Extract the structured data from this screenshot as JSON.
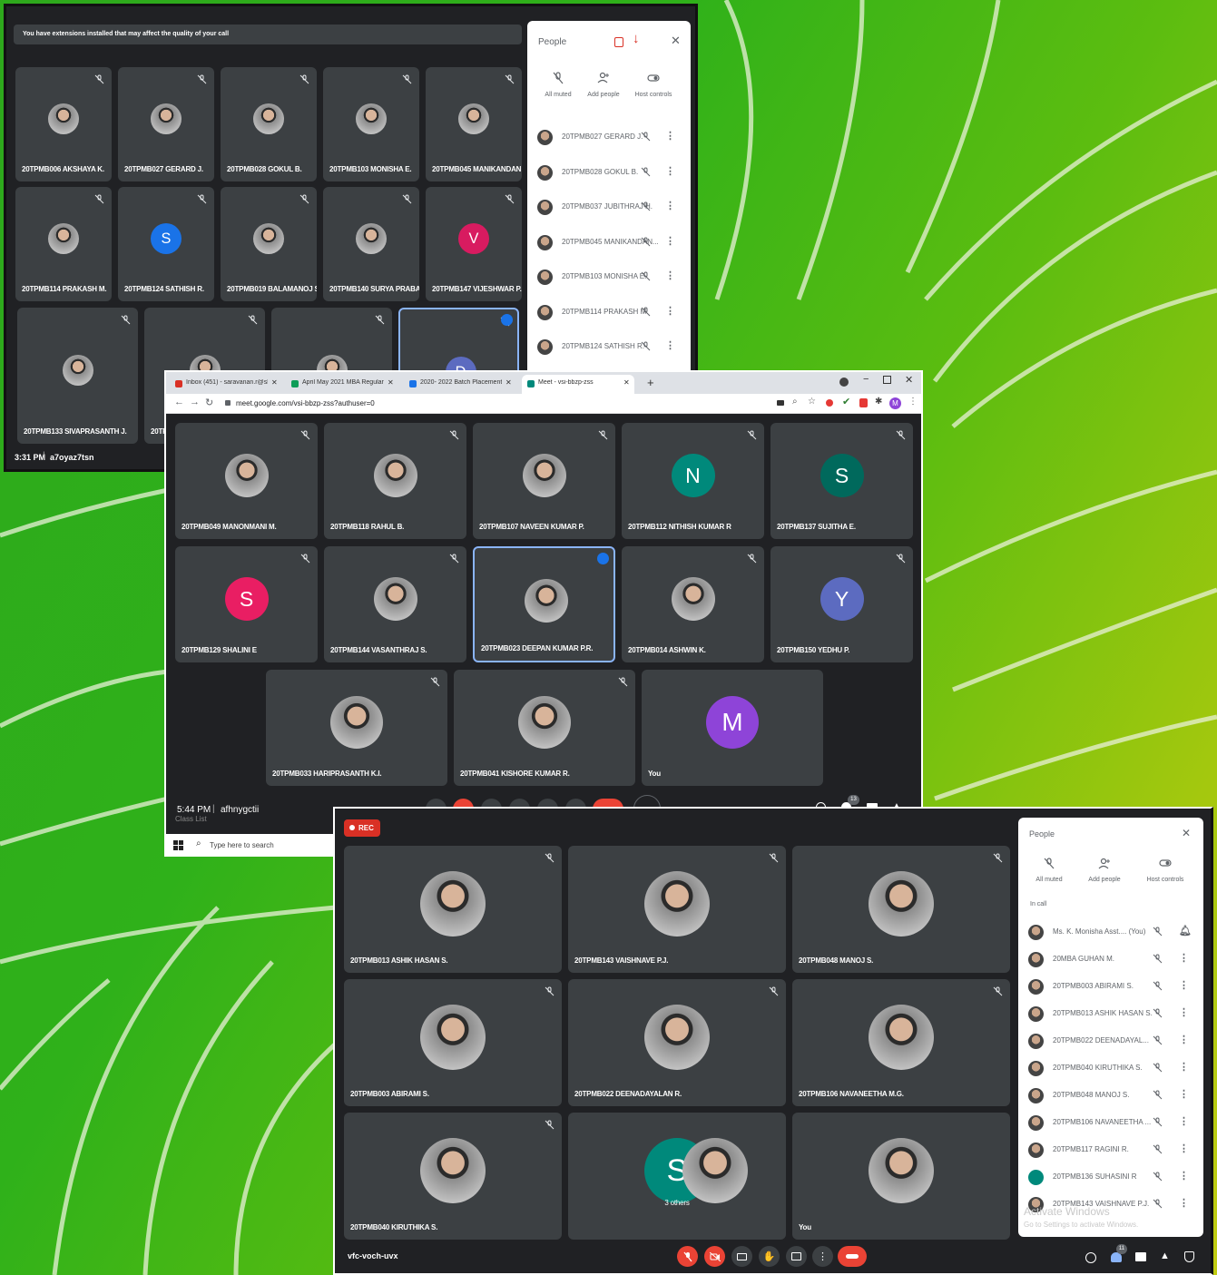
{
  "win1": {
    "banner": "You have extensions installed that may affect the quality of your call",
    "tiles": [
      {
        "name": "20TPMB006 AKSHAYA K.",
        "av": "photo"
      },
      {
        "name": "20TPMB027 GERARD J.",
        "av": "photo"
      },
      {
        "name": "20TPMB028 GOKUL B.",
        "av": "photo"
      },
      {
        "name": "20TPMB103 MONISHA E.",
        "av": "photo"
      },
      {
        "name": "20TPMB045 MANIKANDAN S...",
        "av": "photo"
      },
      {
        "name": "20TPMB114 PRAKASH M.",
        "av": "photo"
      },
      {
        "name": "20TPMB124 SATHISH R.",
        "av": "S",
        "color": "#1a73e8"
      },
      {
        "name": "20TPMB019 BALAMANOJ S.",
        "av": "photo"
      },
      {
        "name": "20TPMB140 SURYA PRABA S.",
        "av": "photo"
      },
      {
        "name": "20TPMB147 VIJESHWAR P.",
        "av": "V",
        "color": "#d81b60"
      },
      {
        "name": "20TPMB133 SIVAPRASANTH J.",
        "av": "photo"
      },
      {
        "name": "20TPN",
        "av": "photo"
      },
      {
        "name": "",
        "av": "photo"
      },
      {
        "name": "",
        "av": "D",
        "color": "#5c6bc0"
      }
    ],
    "time": "3:31 PM",
    "code": "a7oyaz7tsn",
    "people": {
      "title": "People",
      "actions": [
        "All muted",
        "Add people",
        "Host controls"
      ],
      "list": [
        "20TPMB027 GERARD J.",
        "20TPMB028 GOKUL B.",
        "20TPMB037 JUBITHRAJ H.",
        "20TPMB045 MANIKANDAN...",
        "20TPMB103 MONISHA E.",
        "20TPMB114 PRAKASH M.",
        "20TPMB124 SATHISH R."
      ]
    }
  },
  "win2": {
    "tabs": [
      "Inbox (451) - saravanan.r@skct.e",
      "April May 2021 MBA Regular Ex:",
      "2020- 2022 Batch Placement",
      "Meet - vsi-bbzp-zss"
    ],
    "url": "meet.google.com/vsi-bbzp-zss?authuser=0",
    "tiles": [
      {
        "name": "20TPMB049 MANONMANI M.",
        "av": "photo"
      },
      {
        "name": "20TPMB118 RAHUL B.",
        "av": "photo"
      },
      {
        "name": "20TPMB107 NAVEEN KUMAR P.",
        "av": "photo"
      },
      {
        "name": "20TPMB112 NITHISH KUMAR R",
        "av": "N",
        "color": "#00897b"
      },
      {
        "name": "20TPMB137 SUJITHA E.",
        "av": "S",
        "color": "#00695c"
      },
      {
        "name": "20TPMB129 SHALINI E",
        "av": "S",
        "color": "#e91e63"
      },
      {
        "name": "20TPMB144 VASANTHRAJ S.",
        "av": "photo"
      },
      {
        "name": "20TPMB023 DEEPAN KUMAR P.R.",
        "av": "photo"
      },
      {
        "name": "20TPMB014 ASHWIN K.",
        "av": "photo"
      },
      {
        "name": "20TPMB150 YEDHU P.",
        "av": "Y",
        "color": "#5c6bc0"
      },
      {
        "name": "20TPMB033 HARIPRASANTH K.I.",
        "av": "photo"
      },
      {
        "name": "20TPMB041 KISHORE KUMAR R.",
        "av": "photo"
      },
      {
        "name": "You",
        "av": "M",
        "color": "#8e44d8"
      }
    ],
    "time": "5:44 PM",
    "code": "afhnygctii",
    "badge": "13",
    "search": "Type here to search",
    "classlist": "Class List"
  },
  "win3": {
    "rec": "REC",
    "tiles": [
      {
        "name": "20TPMB013 ASHIK HASAN S.",
        "av": "photo"
      },
      {
        "name": "20TPMB143 VAISHNAVE P.J.",
        "av": "photo"
      },
      {
        "name": "20TPMB048 MANOJ S.",
        "av": "photo"
      },
      {
        "name": "20TPMB003 ABIRAMI S.",
        "av": "photo"
      },
      {
        "name": "20TPMB022 DEENADAYALAN R.",
        "av": "photo"
      },
      {
        "name": "20TPMB106 NAVANEETHA M.G.",
        "av": "photo"
      },
      {
        "name": "20TPMB040 KIRUTHIKA S.",
        "av": "photo"
      },
      {
        "name": "3 others",
        "av": "S",
        "color": "#00897b"
      },
      {
        "name": "You",
        "av": "photo"
      }
    ],
    "code": "vfc-voch-uvx",
    "badge": "11",
    "people": {
      "title": "People",
      "actions": [
        "All muted",
        "Add people",
        "Host controls"
      ],
      "section": "In call",
      "list": [
        "Ms. K. Monisha Asst.... (You)",
        "20MBA GUHAN M.",
        "20TPMB003 ABIRAMI S.",
        "20TPMB013 ASHIK HASAN S.",
        "20TPMB022 DEENADAYAL...",
        "20TPMB040 KIRUTHIKA S.",
        "20TPMB048 MANOJ S.",
        "20TPMB106 NAVANEETHA ...",
        "20TPMB117 RAGINI R.",
        "20TPMB136 SUHASINI R",
        "20TPMB143 VAISHNAVE P.J."
      ],
      "watermark1": "Activate Windows",
      "watermark2": "Go to Settings to activate Windows."
    }
  }
}
